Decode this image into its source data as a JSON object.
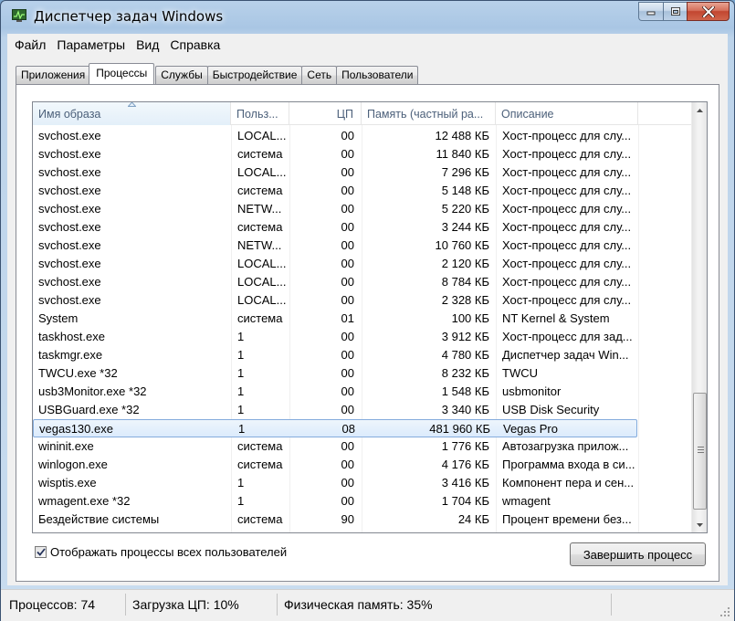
{
  "window": {
    "title": "Диспетчер задач Windows",
    "accent": "#3c73b4",
    "close_color": "#c24630"
  },
  "menu": [
    "Файл",
    "Параметры",
    "Вид",
    "Справка"
  ],
  "tabs": [
    "Приложения",
    "Процессы",
    "Службы",
    "Быстродействие",
    "Сеть",
    "Пользователи"
  ],
  "active_tab": "Процессы",
  "columns": {
    "name": "Имя образа",
    "user": "Польз...",
    "cpu": "ЦП",
    "mem": "Память (частный ра...",
    "desc": "Описание"
  },
  "rows": [
    {
      "name": "svchost.exe",
      "user": "LOCAL...",
      "cpu": "00",
      "mem": "12 488 КБ",
      "desc": "Хост-процесс для слу..."
    },
    {
      "name": "svchost.exe",
      "user": "система",
      "cpu": "00",
      "mem": "11 840 КБ",
      "desc": "Хост-процесс для слу..."
    },
    {
      "name": "svchost.exe",
      "user": "LOCAL...",
      "cpu": "00",
      "mem": "7 296 КБ",
      "desc": "Хост-процесс для слу..."
    },
    {
      "name": "svchost.exe",
      "user": "система",
      "cpu": "00",
      "mem": "5 148 КБ",
      "desc": "Хост-процесс для слу..."
    },
    {
      "name": "svchost.exe",
      "user": "NETW...",
      "cpu": "00",
      "mem": "5 220 КБ",
      "desc": "Хост-процесс для слу..."
    },
    {
      "name": "svchost.exe",
      "user": "система",
      "cpu": "00",
      "mem": "3 244 КБ",
      "desc": "Хост-процесс для слу..."
    },
    {
      "name": "svchost.exe",
      "user": "NETW...",
      "cpu": "00",
      "mem": "10 760 КБ",
      "desc": "Хост-процесс для слу..."
    },
    {
      "name": "svchost.exe",
      "user": "LOCAL...",
      "cpu": "00",
      "mem": "2 120 КБ",
      "desc": "Хост-процесс для слу..."
    },
    {
      "name": "svchost.exe",
      "user": "LOCAL...",
      "cpu": "00",
      "mem": "8 784 КБ",
      "desc": "Хост-процесс для слу..."
    },
    {
      "name": "svchost.exe",
      "user": "LOCAL...",
      "cpu": "00",
      "mem": "2 328 КБ",
      "desc": "Хост-процесс для слу..."
    },
    {
      "name": "System",
      "user": "система",
      "cpu": "01",
      "mem": "100 КБ",
      "desc": "NT Kernel & System"
    },
    {
      "name": "taskhost.exe",
      "user": "1",
      "cpu": "00",
      "mem": "3 912 КБ",
      "desc": "Хост-процесс для зад..."
    },
    {
      "name": "taskmgr.exe",
      "user": "1",
      "cpu": "00",
      "mem": "4 780 КБ",
      "desc": "Диспетчер задач Win..."
    },
    {
      "name": "TWCU.exe *32",
      "user": "1",
      "cpu": "00",
      "mem": "8 232 КБ",
      "desc": "TWCU"
    },
    {
      "name": "usb3Monitor.exe *32",
      "user": "1",
      "cpu": "00",
      "mem": "1 548 КБ",
      "desc": "usbmonitor"
    },
    {
      "name": "USBGuard.exe *32",
      "user": "1",
      "cpu": "00",
      "mem": "3 340 КБ",
      "desc": "USB Disk Security"
    },
    {
      "name": "vegas130.exe",
      "user": "1",
      "cpu": "08",
      "mem": "481 960 КБ",
      "desc": "Vegas Pro",
      "selected": true
    },
    {
      "name": "wininit.exe",
      "user": "система",
      "cpu": "00",
      "mem": "1 776 КБ",
      "desc": "Автозагрузка прилож..."
    },
    {
      "name": "winlogon.exe",
      "user": "система",
      "cpu": "00",
      "mem": "4 176 КБ",
      "desc": "Программа входа в си..."
    },
    {
      "name": "wisptis.exe",
      "user": "1",
      "cpu": "00",
      "mem": "3 416 КБ",
      "desc": "Компонент пера и сен..."
    },
    {
      "name": "wmagent.exe *32",
      "user": "1",
      "cpu": "00",
      "mem": "1 704 КБ",
      "desc": "wmagent"
    },
    {
      "name": "Бездействие системы",
      "user": "система",
      "cpu": "90",
      "mem": "24 КБ",
      "desc": "Процент времени без..."
    }
  ],
  "show_all_label": "Отображать процессы всех пользователей",
  "show_all_checked": true,
  "end_process_label": "Завершить процесс",
  "status": {
    "processes": "Процессов: 74",
    "cpu": "Загрузка ЦП: 10%",
    "memory": "Физическая память: 35%"
  }
}
